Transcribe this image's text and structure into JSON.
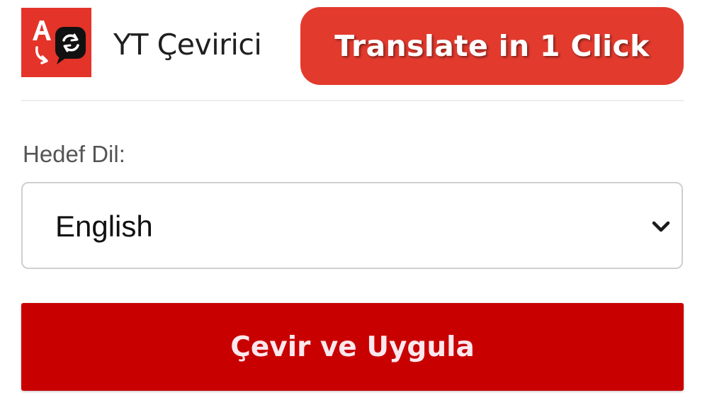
{
  "header": {
    "logo_icon": "translate-app-logo-icon",
    "app_title": "YT Çevirici",
    "promo_text": "Translate in 1 Click"
  },
  "form": {
    "target_language_label": "Hedef Dil:",
    "target_language_value": "English",
    "dropdown_icon": "chevron-down-icon",
    "submit_label": "Çevir ve Uygula"
  },
  "colors": {
    "brand_red": "#e43329",
    "promo_red": "#e33a2e",
    "button_red": "#c80000"
  }
}
